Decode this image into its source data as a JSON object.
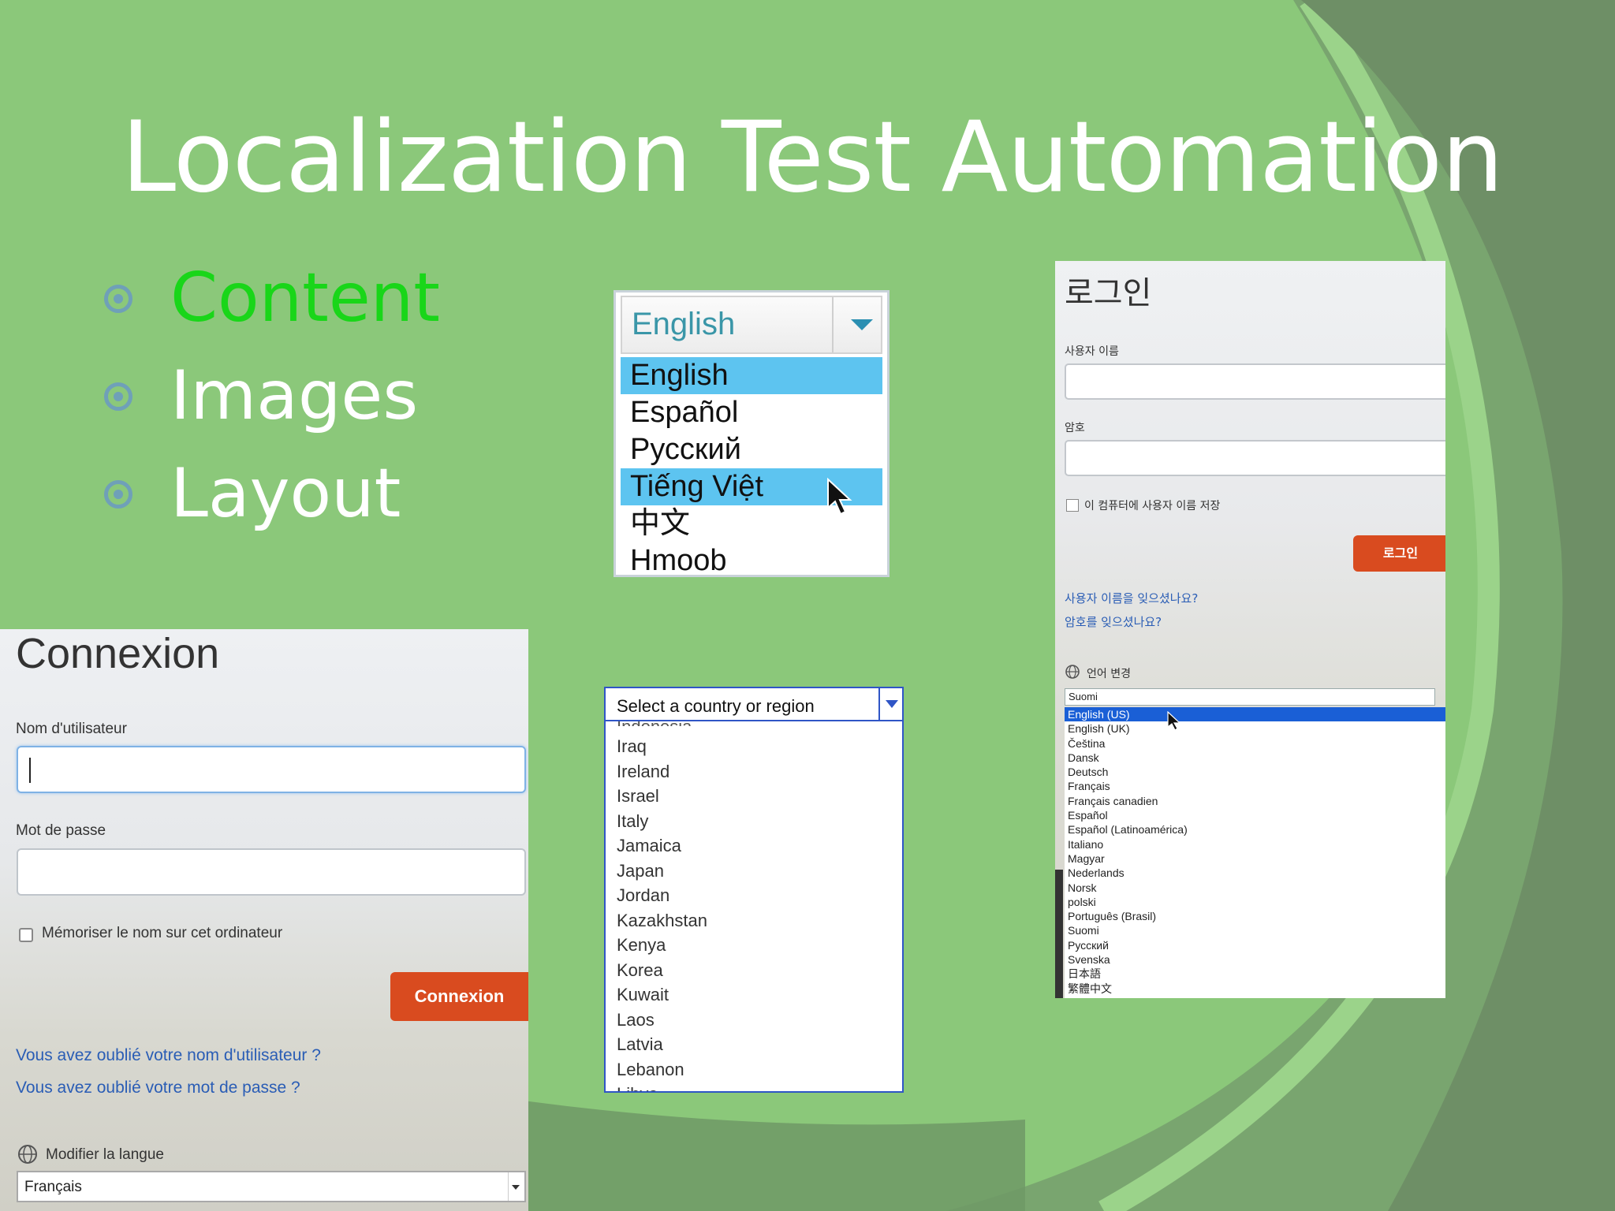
{
  "slide": {
    "title": "Localization Test Automation",
    "bullets": [
      "Content",
      "Images",
      "Layout"
    ]
  },
  "language_dropdown": {
    "selected": "English",
    "options": [
      "English",
      "Español",
      "Русский",
      "Tiếng Việt",
      "中文",
      "Hmoob"
    ],
    "highlighted": [
      "English",
      "Tiếng Việt"
    ]
  },
  "country_dropdown": {
    "placeholder": "Select a country or region",
    "partial_top": "Indonesia",
    "options": [
      "Iraq",
      "Ireland",
      "Israel",
      "Italy",
      "Jamaica",
      "Japan",
      "Jordan",
      "Kazakhstan",
      "Kenya",
      "Korea",
      "Kuwait",
      "Laos",
      "Latvia",
      "Lebanon",
      "Libya"
    ]
  },
  "french_login": {
    "title": "Connexion",
    "username_label": "Nom d'utilisateur",
    "password_label": "Mot de passe",
    "remember_label": "Mémoriser le nom sur cet ordinateur",
    "submit_label": "Connexion",
    "forgot_username": "Vous avez oublié votre nom d'utilisateur ?",
    "forgot_password": "Vous avez oublié votre mot de passe ?",
    "change_language_label": "Modifier la langue",
    "language_value": "Français"
  },
  "korean_login": {
    "title": "로그인",
    "username_label": "사용자 이름",
    "password_label": "암호",
    "remember_label": "이 컴퓨터에 사용자 이름 저장",
    "submit_label": "로그인",
    "forgot_username": "사용자 이름을 잊으셨나요?",
    "forgot_password": "암호를 잊으셨나요?",
    "change_language_label": "언어 변경",
    "language_value": "Suomi",
    "language_options": [
      "English (US)",
      "English (UK)",
      "Čeština",
      "Dansk",
      "Deutsch",
      "Français",
      "Français canadien",
      "Español",
      "Español (Latinoamérica)",
      "Italiano",
      "Magyar",
      "Nederlands",
      "Norsk",
      "polski",
      "Português (Brasil)",
      "Suomi",
      "Русский",
      "Svenska",
      "日本語",
      "繁體中文"
    ],
    "selected_option": "English (US)"
  },
  "colors": {
    "background": "#8bc87a",
    "accent_active": "#19d619",
    "bullet": "#6fa0b8",
    "button": "#d94b1f",
    "link": "#2a5db5",
    "highlight": "#5dc4f0",
    "list_selected": "#1a5fd6"
  }
}
